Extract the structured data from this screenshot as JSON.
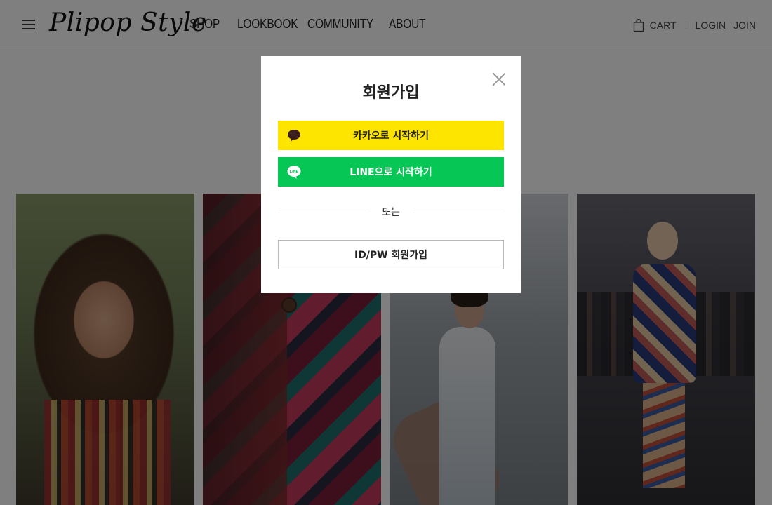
{
  "header": {
    "logo": "Plipop Style",
    "nav": [
      "SHOP",
      "LOOKBOOK",
      "COMMUNITY",
      "ABOUT"
    ],
    "cart_label": "CART",
    "login_label": "LOGIN",
    "join_label": "JOIN"
  },
  "modal": {
    "title": "회원가입",
    "kakao_label": "카카오로 시작하기",
    "line_label": "LINE으로 시작하기",
    "line_icon_text": "LINE",
    "divider_text": "또는",
    "idpw_label": "ID/PW 회원가입"
  },
  "colors": {
    "kakao": "#fee500",
    "line": "#06c755",
    "overlay": "rgba(0,0,0,0.5)"
  },
  "icons": [
    "hamburger-icon",
    "cart-icon",
    "close-icon",
    "kakao-talk-icon",
    "line-icon"
  ]
}
